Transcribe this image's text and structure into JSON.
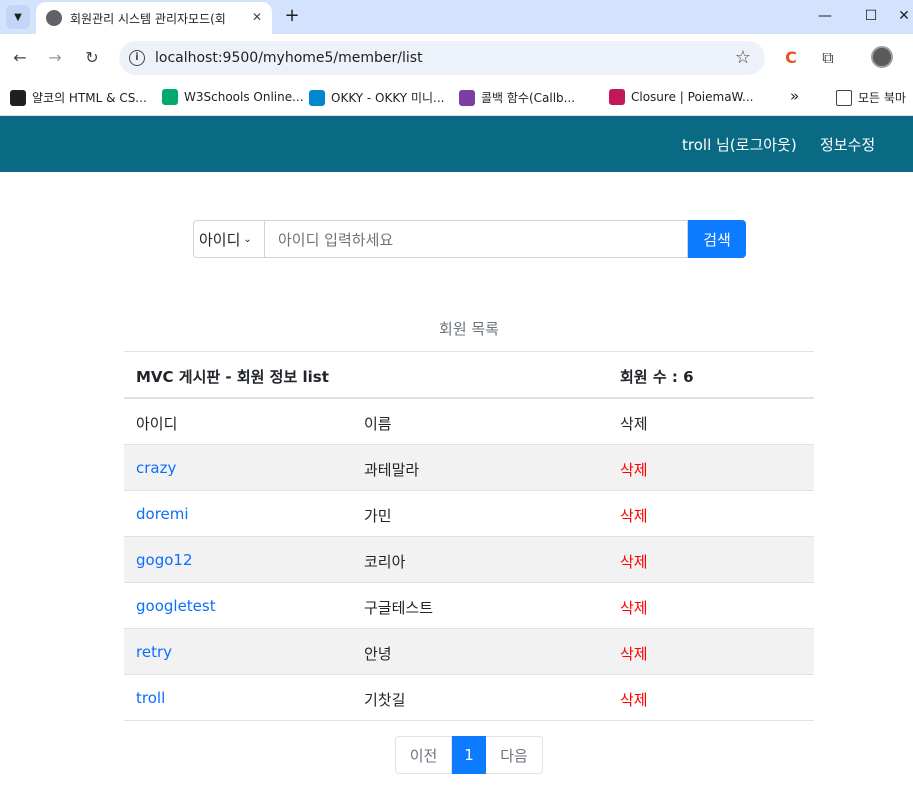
{
  "browser": {
    "tab_title": "회원관리 시스템 관리자모드(회",
    "new_tab": "+",
    "url": "localhost:9500/myhome5/member/list",
    "bookmarks": [
      {
        "label": "얄코의 HTML & CS...",
        "color": "#1f1f1f"
      },
      {
        "label": "W3Schools Online...",
        "color": "#04aa6d"
      },
      {
        "label": "OKKY - OKKY 미니...",
        "color": "#0088cc"
      },
      {
        "label": "콜백 함수(Callb...",
        "color": "#7b3fa0"
      },
      {
        "label": "Closure | PoiemaW...",
        "color": "#c2185b"
      }
    ],
    "bookmarks_more": "»",
    "all_bookmarks": "모든 북마"
  },
  "navbar": {
    "user_logout": "troll 님(로그아웃)",
    "edit_info": "정보수정",
    "bg_color": "#0b6a83"
  },
  "search": {
    "field_selected": "아이디",
    "placeholder": "아이디 입력하세요",
    "button": "검색"
  },
  "table": {
    "caption": "회원 목록",
    "title": "MVC 게시판 - 회원 정보 list",
    "count_label": "회원 수 : 6",
    "columns": [
      "아이디",
      "이름",
      "삭제"
    ],
    "rows": [
      {
        "id": "crazy",
        "name": "과테말라",
        "delete": "삭제"
      },
      {
        "id": "doremi",
        "name": "가민",
        "delete": "삭제"
      },
      {
        "id": "gogo12",
        "name": "코리아",
        "delete": "삭제"
      },
      {
        "id": "googletest",
        "name": "구글테스트",
        "delete": "삭제"
      },
      {
        "id": "retry",
        "name": "안녕",
        "delete": "삭제"
      },
      {
        "id": "troll",
        "name": "기찻길",
        "delete": "삭제"
      }
    ]
  },
  "pagination": {
    "prev": "이전",
    "current": "1",
    "next": "다음"
  }
}
